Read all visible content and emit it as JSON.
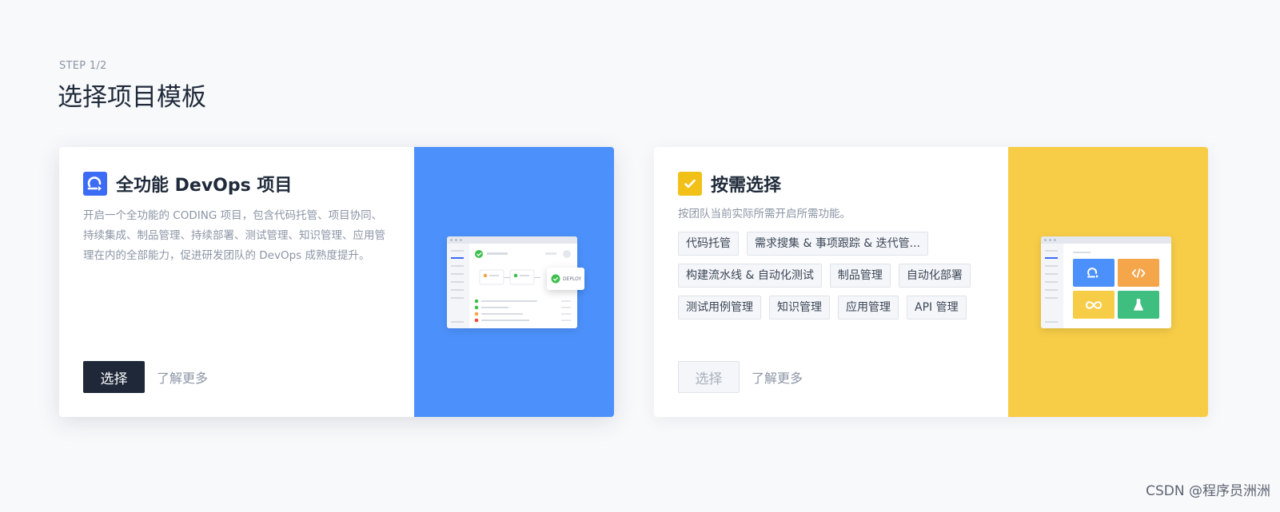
{
  "header": {
    "step": "STEP 1/2",
    "title": "选择项目模板"
  },
  "cards": [
    {
      "icon": "devops-logo-icon",
      "title": "全功能 DevOps 项目",
      "description": "开启一个全功能的 CODING 项目，包含代码托管、项目协同、持续集成、制品管理、持续部署、测试管理、知识管理、应用管理在内的全部能力，促进研发团队的 DevOps 成熟度提升。",
      "select_label": "选择",
      "learn_more": "了解更多",
      "accent": "#4c91fb",
      "illustration_badge": "DEPLOY"
    },
    {
      "icon": "checkbox-icon",
      "title": "按需选择",
      "description": "按团队当前实际所需开启所需功能。",
      "tags": [
        "代码托管",
        "需求搜集 & 事项跟踪 & 迭代管...",
        "构建流水线 & 自动化测试",
        "制品管理",
        "自动化部署",
        "测试用例管理",
        "知识管理",
        "应用管理",
        "API 管理"
      ],
      "select_label": "选择",
      "learn_more": "了解更多",
      "accent": "#f7cd47"
    }
  ],
  "watermark": "CSDN @程序员洲洲",
  "colors": {
    "background": "#f8f9fb",
    "primary_button": "#1e2838",
    "devops_icon": "#3c6cf5",
    "check_icon": "#f2c118"
  }
}
